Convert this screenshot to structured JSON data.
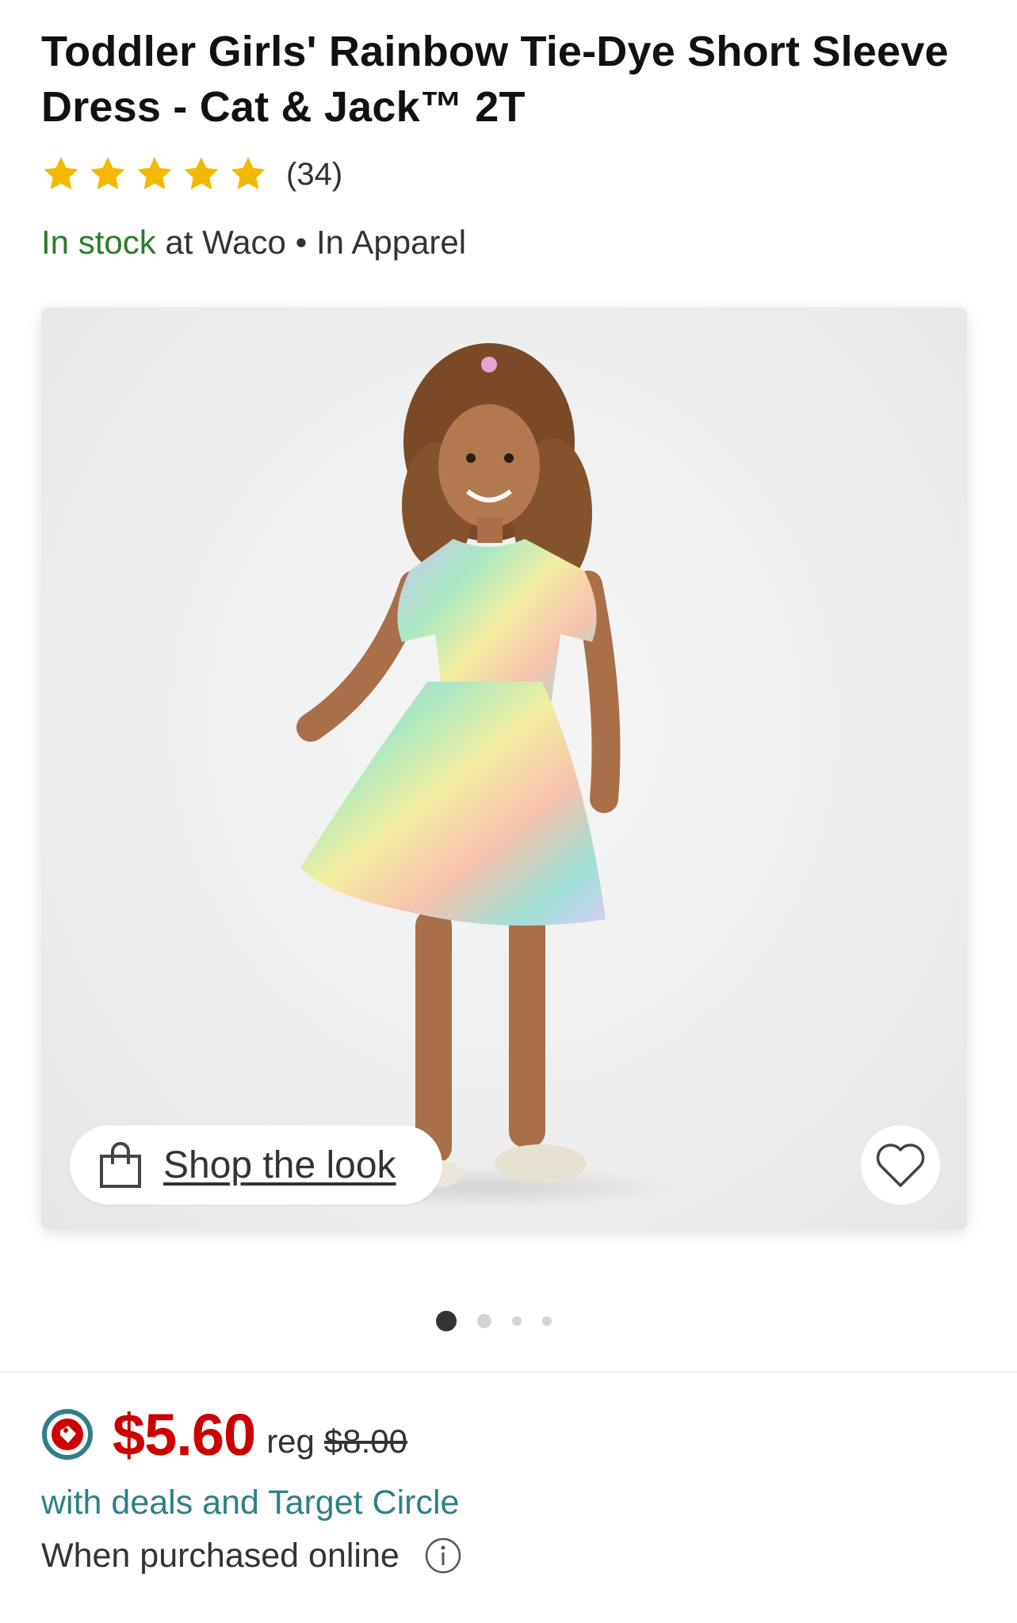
{
  "product": {
    "title": "Toddler Girls' Rainbow Tie-Dye Short Sleeve Dress - Cat & Jack™ 2T",
    "rating_stars": 5,
    "review_count": "(34)",
    "availability": {
      "stock": "In stock",
      "location": "at Waco",
      "separator": "•",
      "department": "In Apparel"
    }
  },
  "gallery": {
    "image_alt": "girl-wearing-tie-dye-dress",
    "shop_the_look_label": "Shop the look",
    "favorite_icon": "heart-outline-icon",
    "bag_icon": "shopping-bag-icon",
    "pagination": {
      "total": 4,
      "active": 1
    }
  },
  "pricing": {
    "price": "$5.60",
    "reg_label": "reg",
    "reg_price": "$8.00",
    "deals_text": "with deals and Target Circle",
    "purchase_note": "When purchased online",
    "circle_icon": "target-circle-icon",
    "info_icon": "info-icon"
  },
  "colors": {
    "price_red": "#cc0000",
    "stock_green": "#2a7d2a",
    "deals_teal": "#2e7f8a",
    "text_dark": "#333333"
  }
}
